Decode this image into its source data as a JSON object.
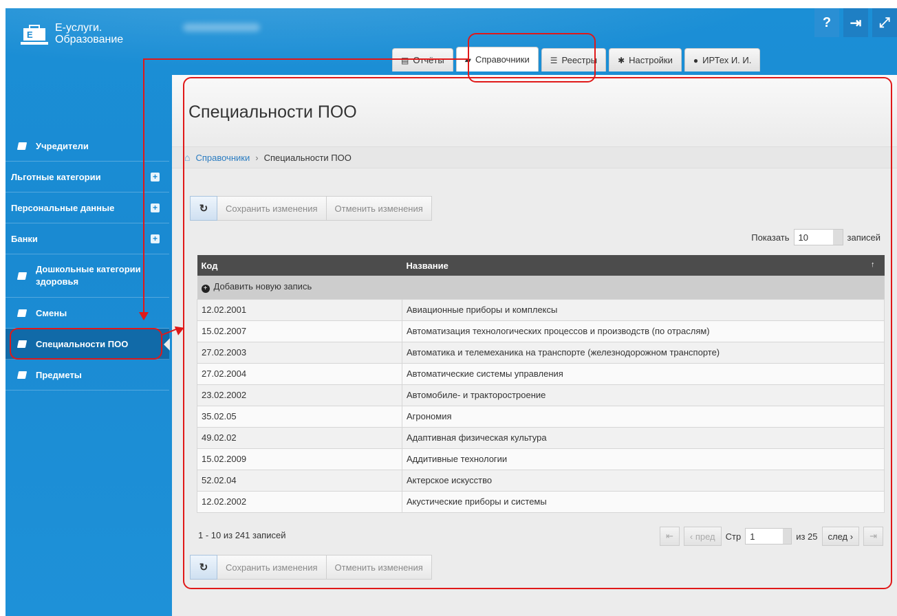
{
  "app": {
    "name_line1": "Е-услуги.",
    "name_line2": "Образование",
    "logo_letter": "E"
  },
  "top_icons": [
    {
      "name": "help-icon",
      "glyph": "?"
    },
    {
      "name": "logout-icon",
      "glyph": "⇥"
    },
    {
      "name": "fullscreen-icon",
      "glyph": "⤢"
    }
  ],
  "tabs": [
    {
      "label": "Отчёты",
      "icon": "report-icon",
      "glyph": "▤"
    },
    {
      "label": "Справочники",
      "icon": "book-icon",
      "glyph": "▰",
      "active": true
    },
    {
      "label": "Реестры",
      "icon": "list-icon",
      "glyph": "☰"
    },
    {
      "label": "Настройки",
      "icon": "gear-icon",
      "glyph": "✱"
    },
    {
      "label": "ИРТех И. И.",
      "icon": "user-icon",
      "glyph": "●"
    }
  ],
  "sidebar": {
    "items": [
      {
        "label": "Учредители",
        "icon": true,
        "plus": false
      },
      {
        "label": "Льготные категории",
        "icon": false,
        "plus": true
      },
      {
        "label": "Персональные данные",
        "icon": false,
        "plus": true
      },
      {
        "label": "Банки",
        "icon": false,
        "plus": true
      },
      {
        "label": "Дошкольные категории здоровья",
        "icon": true,
        "plus": false
      },
      {
        "label": "Смены",
        "icon": true,
        "plus": false
      },
      {
        "label": "Специальности ПОО",
        "icon": true,
        "plus": false,
        "active": true
      },
      {
        "label": "Предметы",
        "icon": true,
        "plus": false
      }
    ]
  },
  "page": {
    "title": "Специальности ПОО",
    "breadcrumb": {
      "root": "Справочники",
      "current": "Специальности ПОО",
      "separator": "›"
    },
    "toolbar": {
      "save_label": "Сохранить изменения",
      "cancel_label": "Отменить изменения",
      "refresh_glyph": "↻"
    },
    "show": {
      "prefix": "Показать",
      "value": "10",
      "suffix": "записей"
    }
  },
  "table": {
    "columns": [
      "Код",
      "Название"
    ],
    "sort_glyph": "↑",
    "add_label": "Добавить новую запись",
    "rows": [
      {
        "code": "12.02.2001",
        "name": "Авиационные приборы и комплексы"
      },
      {
        "code": "15.02.2007",
        "name": "Автоматизация технологических процессов и производств (по отраслям)"
      },
      {
        "code": "27.02.2003",
        "name": "Автоматика и телемеханика на транспорте (железнодорожном транспорте)"
      },
      {
        "code": "27.02.2004",
        "name": "Автоматические системы управления"
      },
      {
        "code": "23.02.2002",
        "name": "Автомобиле- и тракторостроение"
      },
      {
        "code": "35.02.05",
        "name": "Агрономия"
      },
      {
        "code": "49.02.02",
        "name": "Адаптивная физическая культура"
      },
      {
        "code": "15.02.2009",
        "name": "Аддитивные технологии"
      },
      {
        "code": "52.02.04",
        "name": "Актерское искусство"
      },
      {
        "code": "12.02.2002",
        "name": "Акустические приборы и системы"
      }
    ]
  },
  "footer": {
    "records_info": "1 - 10 из 241 записей",
    "pager": {
      "prev": "пред",
      "page_label": "Стр",
      "page": "1",
      "of": "из 25",
      "next": "след"
    }
  },
  "colors": {
    "accent": "#1a8ad2",
    "annotation": "#e01818",
    "header_dark": "#4c4c4c"
  }
}
